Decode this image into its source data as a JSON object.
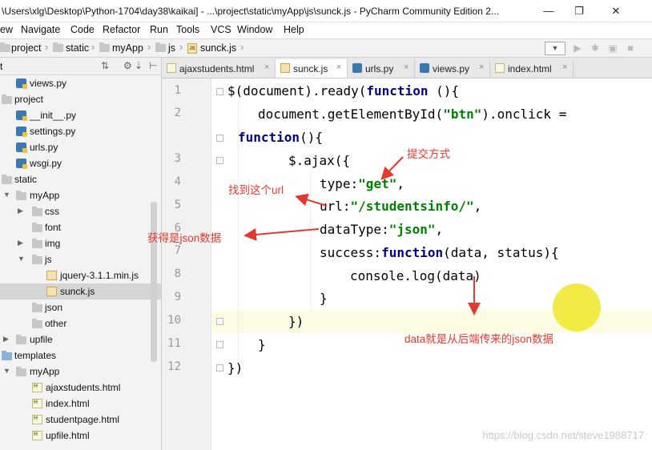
{
  "window": {
    "title": "\\Users\\xlg\\Desktop\\Python-1704\\day38\\kaikai] - ...\\project\\static\\myApp\\js\\sunck.js - PyCharm Community Edition 2...",
    "minimize": "—",
    "maximize": "❐",
    "close": "✕"
  },
  "menu": [
    {
      "label": "ew"
    },
    {
      "label": "Navigate"
    },
    {
      "label": "Code"
    },
    {
      "label": "Refactor"
    },
    {
      "label": "Run"
    },
    {
      "label": "Tools"
    },
    {
      "label": "VCS"
    },
    {
      "label": "Window"
    },
    {
      "label": "Help"
    }
  ],
  "breadcrumb": [
    "project",
    "static",
    "myApp",
    "js",
    "sunck.js"
  ],
  "project_panel": {
    "header": "t",
    "rows": [
      {
        "label": "views.py",
        "icon": "python-file-icon"
      },
      {
        "label": "project",
        "icon": "folder-icon"
      },
      {
        "label": "__init__.py",
        "icon": "python-file-icon"
      },
      {
        "label": "settings.py",
        "icon": "python-file-icon"
      },
      {
        "label": "urls.py",
        "icon": "python-file-icon"
      },
      {
        "label": "wsgi.py",
        "icon": "python-file-icon"
      },
      {
        "label": "static",
        "icon": "folder-icon"
      },
      {
        "label": "myApp",
        "icon": "folder-icon"
      },
      {
        "label": "css",
        "icon": "folder-icon"
      },
      {
        "label": "font",
        "icon": "folder-icon"
      },
      {
        "label": "img",
        "icon": "folder-icon"
      },
      {
        "label": "js",
        "icon": "folder-icon"
      },
      {
        "label": "jquery-3.1.1.min.js",
        "icon": "js-file-icon"
      },
      {
        "label": "sunck.js",
        "icon": "js-file-icon"
      },
      {
        "label": "json",
        "icon": "folder-icon"
      },
      {
        "label": "other",
        "icon": "folder-icon"
      },
      {
        "label": "upfile",
        "icon": "folder-icon"
      },
      {
        "label": "templates",
        "icon": "folder-icon"
      },
      {
        "label": "myApp",
        "icon": "folder-icon"
      },
      {
        "label": "ajaxstudents.html",
        "icon": "html-file-icon"
      },
      {
        "label": "index.html",
        "icon": "html-file-icon"
      },
      {
        "label": "studentpage.html",
        "icon": "html-file-icon"
      },
      {
        "label": "upfile.html",
        "icon": "html-file-icon"
      }
    ]
  },
  "tabs": [
    {
      "label": "ajaxstudents.html",
      "close": "×"
    },
    {
      "label": "sunck.js",
      "close": "×"
    },
    {
      "label": "urls.py",
      "close": "×"
    },
    {
      "label": "views.py",
      "close": "×"
    },
    {
      "label": "index.html",
      "close": "×"
    }
  ],
  "editor": {
    "line_numbers": [
      "1",
      "2",
      "3",
      "4",
      "5",
      "6",
      "7",
      "8",
      "9",
      "10",
      "11",
      "12"
    ],
    "code": {
      "l1a": "$(document).ready(",
      "l1kw": "function",
      "l1b": " (){",
      "l2": "document.getElementById(",
      "l2s": "\"btn\"",
      "l2b": ").onclick =",
      "l2c_kw": "function",
      "l2c": "(){",
      "l3": "$.ajax({",
      "l4a": "type:",
      "l4s": "\"get\"",
      "l4b": ",",
      "l5a": "url:",
      "l5s": "\"/studentsinfo/\"",
      "l5b": ",",
      "l6a": "dataType:",
      "l6s": "\"json\"",
      "l6b": ",",
      "l7a": "success:",
      "l7kw": "function",
      "l7b": "(data, status){",
      "l8": "console.log(data)",
      "l9": "}",
      "l10": "})",
      "l11": "}",
      "l12": "})"
    }
  },
  "annotations": {
    "submit_method": "提交方式",
    "find_url": "找到这个url",
    "get_json": "获得是json数据",
    "data_desc": "data就是从后端传来的json数据"
  },
  "watermark": "https://blog.csdn.net/steve1988717",
  "colors": {
    "annotation": "#e23a2e",
    "keyword": "#000080",
    "string": "#008000",
    "highlight": "#eee828"
  }
}
